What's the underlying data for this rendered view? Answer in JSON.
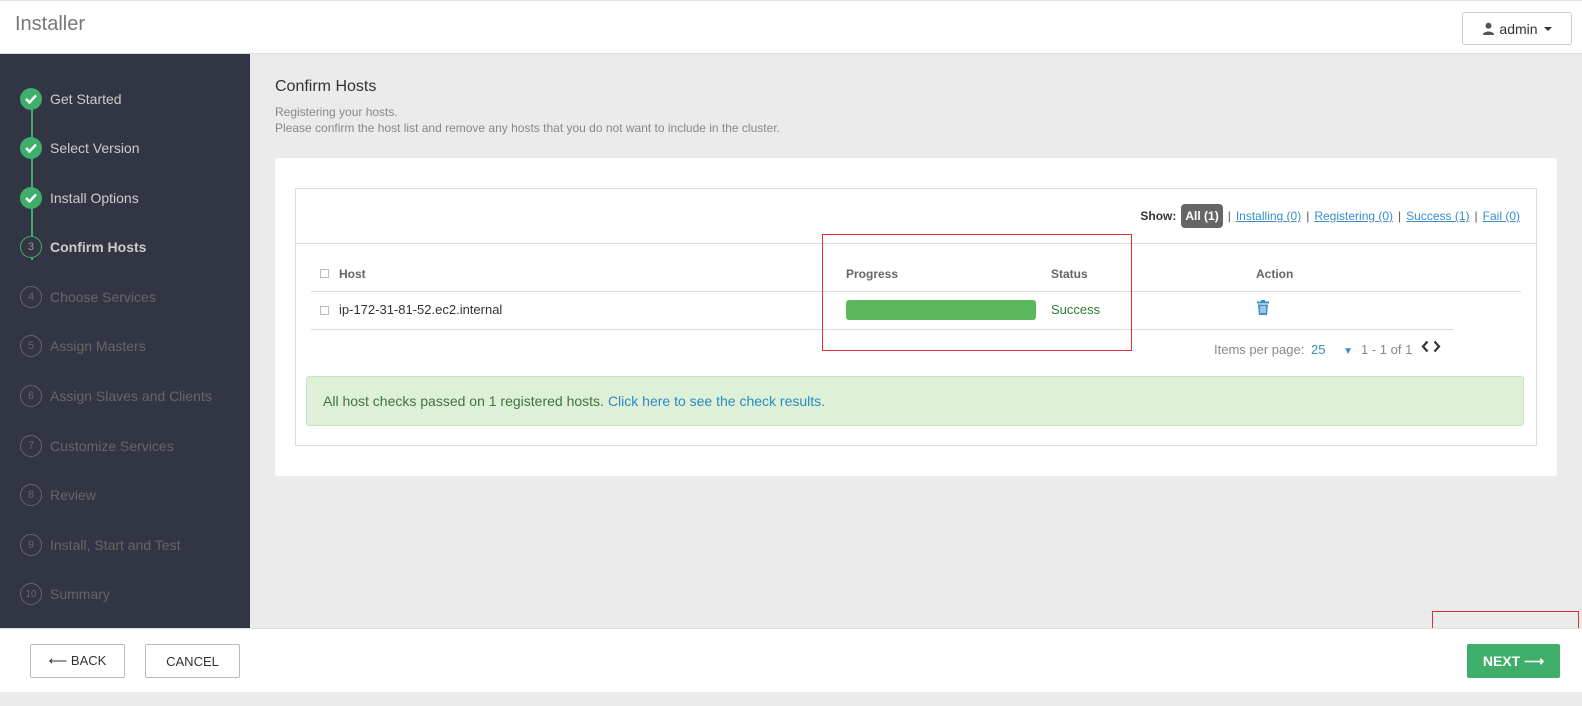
{
  "app": {
    "title": "Installer"
  },
  "user_menu": {
    "label": "admin",
    "icon": "user-icon"
  },
  "wizard": {
    "steps": [
      {
        "num": "",
        "label": "Get Started",
        "state": "done"
      },
      {
        "num": "",
        "label": "Select Version",
        "state": "done"
      },
      {
        "num": "",
        "label": "Install Options",
        "state": "done"
      },
      {
        "num": "3",
        "label": "Confirm Hosts",
        "state": "current"
      },
      {
        "num": "4",
        "label": "Choose Services",
        "state": "pending"
      },
      {
        "num": "5",
        "label": "Assign Masters",
        "state": "pending"
      },
      {
        "num": "6",
        "label": "Assign Slaves and Clients",
        "state": "pending"
      },
      {
        "num": "7",
        "label": "Customize Services",
        "state": "pending"
      },
      {
        "num": "8",
        "label": "Review",
        "state": "pending"
      },
      {
        "num": "9",
        "label": "Install, Start and Test",
        "state": "pending"
      },
      {
        "num": "10",
        "label": "Summary",
        "state": "pending"
      }
    ]
  },
  "page": {
    "title": "Confirm Hosts",
    "desc1": "Registering your hosts.",
    "desc2": "Please confirm the host list and remove any hosts that you do not want to include in the cluster."
  },
  "filters": {
    "show_label": "Show:",
    "all": "All (1)",
    "installing": "Installing (0)",
    "registering": "Registering (0)",
    "success": "Success (1)",
    "fail": "Fail (0)",
    "separator": "|"
  },
  "table": {
    "headers": {
      "host": "Host",
      "progress": "Progress",
      "status": "Status",
      "action": "Action"
    },
    "rows": [
      {
        "host": "ip-172-31-81-52.ec2.internal",
        "progress": 1.0,
        "status": "Success",
        "action_icon": "trash-icon"
      }
    ]
  },
  "pagination": {
    "label": "Items per page:",
    "value": "25",
    "range": "1 - 1 of 1"
  },
  "alert": {
    "text": "All host checks passed on 1 registered hosts.",
    "link": "Click here to see the check results."
  },
  "footer": {
    "back": "⟵ BACK",
    "cancel": "CANCEL",
    "next": "NEXT ⟶"
  },
  "colors": {
    "accent": "#3fae6a",
    "sidebar": "#323544",
    "link": "#3a8fc8",
    "highlight": "#e03030"
  }
}
